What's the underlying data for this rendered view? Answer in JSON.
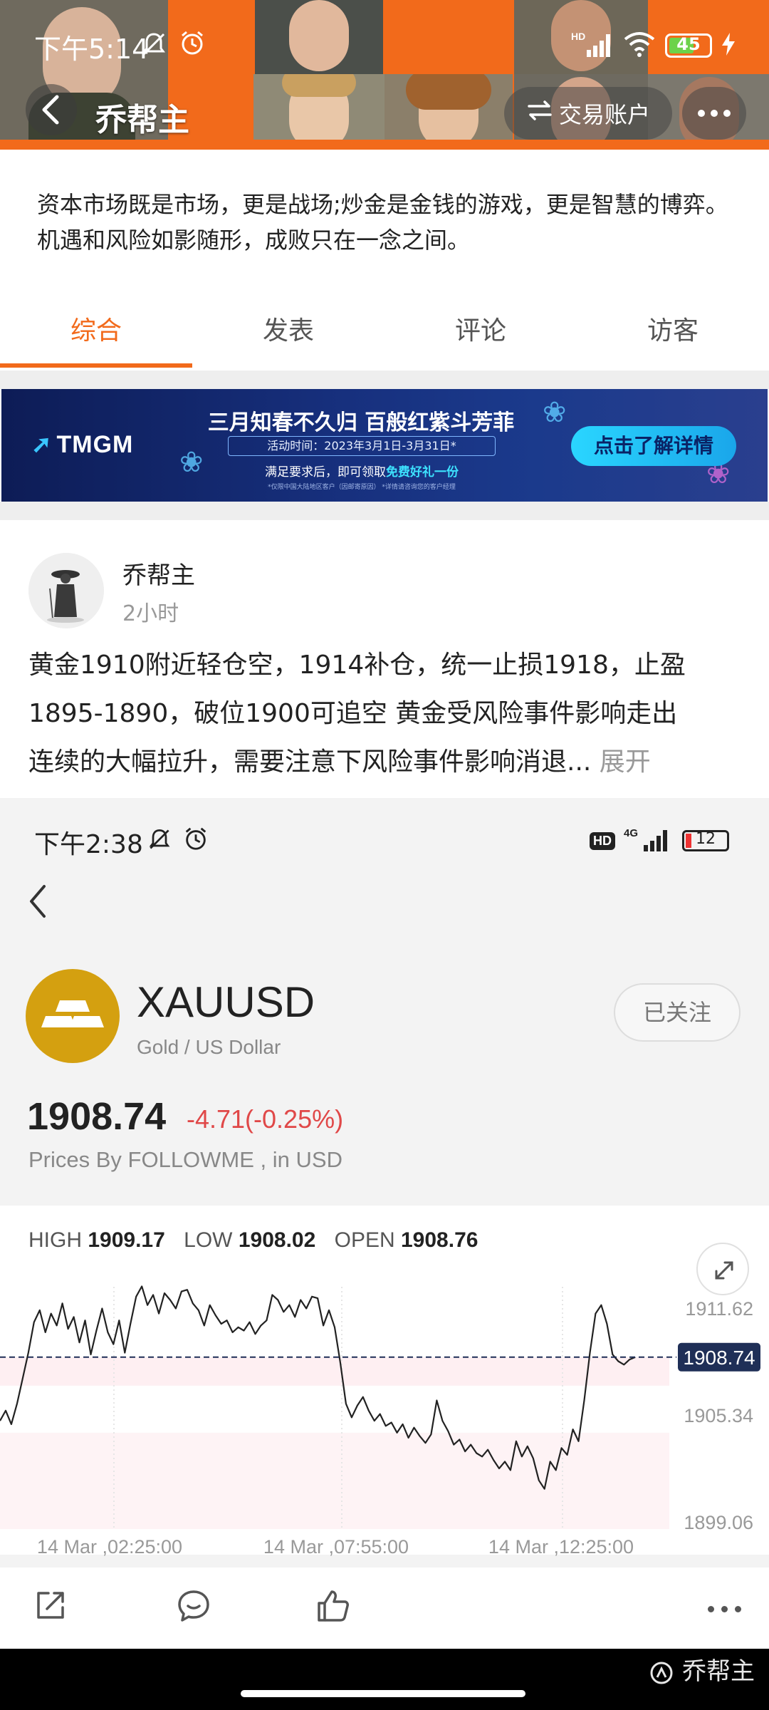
{
  "status_bar": {
    "time": "下午5:14",
    "battery": "45",
    "network": "HD"
  },
  "nav": {
    "title": "乔帮主",
    "trade_label": "交易账户"
  },
  "profile": {
    "bio_line1": "资本市场既是市场，更是战场;炒金是金钱的游戏，更是智慧的博弈。",
    "bio_line2": "机遇和风险如影随形，成败只在一念之间。"
  },
  "tabs": [
    "综合",
    "发表",
    "评论",
    "访客"
  ],
  "banner": {
    "logo": "TMGM",
    "title": "三月知春不久归 百般红紫斗芳菲",
    "date": "活动时间：2023年3月1日-3月31日*",
    "sub_prefix": "满足要求后，即可领取",
    "sub_highlight": "免费好礼一份",
    "note": "*仅限中国大陆地区客户（因邮寄原因） *详情请咨询您的客户经理",
    "cta": "点击了解详情"
  },
  "post": {
    "author": "乔帮主",
    "time": "2小时",
    "line1": "黄金1910附近轻仓空，1914补仓，统一止损1918，止盈",
    "line2": "1895-1890，破位1900可追空 黄金受风险事件影响走出",
    "line3": "连续的大幅拉升，需要注意下风险事件影响消退...",
    "more": "展开"
  },
  "embedded": {
    "status_time": "下午2:38",
    "status_hd": "HD",
    "status_net": "4G",
    "battery": "12",
    "symbol": "XAUUSD",
    "symbol_desc": "Gold / US Dollar",
    "follow_label": "已关注",
    "price": "1908.74",
    "change": "-4.71(-0.25%)",
    "prices_by": "Prices By FOLLOWME , in USD",
    "high_label": "HIGH",
    "high": "1909.17",
    "low_label": "LOW",
    "low": "1908.02",
    "open_label": "OPEN",
    "open": "1908.76"
  },
  "chart_data": {
    "type": "line",
    "y_ticks": [
      "1911.62",
      "1905.34",
      "1899.06"
    ],
    "x_ticks": [
      "14 Mar ,02:25:00",
      "14 Mar ,07:55:00",
      "14 Mar ,12:25:00"
    ],
    "current_price_label": "1908.74",
    "ylim": [
      1899.06,
      1911.62
    ],
    "grid": true,
    "x": [
      0,
      8,
      16,
      24,
      32,
      40,
      48,
      56,
      64,
      72,
      80,
      88,
      96,
      104,
      112,
      120,
      128,
      136,
      144,
      152,
      160,
      168,
      176,
      184,
      192,
      200,
      208,
      216,
      224,
      232,
      240,
      248,
      256,
      264,
      272,
      280,
      288,
      296,
      304,
      312,
      320,
      328,
      336,
      344,
      352,
      360,
      368,
      376,
      384,
      392,
      400,
      408,
      416,
      424,
      432,
      440,
      448,
      456,
      464,
      472,
      480,
      488,
      496,
      504,
      512,
      520,
      528,
      536,
      544,
      552,
      560,
      568,
      576,
      584,
      592,
      600,
      608,
      616,
      624,
      632,
      640,
      648,
      656,
      664,
      672,
      680,
      688,
      696,
      704,
      712,
      720,
      728,
      736,
      744,
      752,
      760,
      768,
      776,
      784,
      792,
      800,
      808,
      816,
      824,
      832,
      840,
      848,
      856,
      864,
      872,
      880,
      888,
      896,
      904,
      912,
      920,
      928,
      936,
      944
    ],
    "values": [
      1905.0,
      1905.6,
      1904.8,
      1906.0,
      1907.5,
      1909.0,
      1910.8,
      1911.5,
      1910.2,
      1911.3,
      1910.6,
      1911.9,
      1910.4,
      1911.1,
      1909.6,
      1910.9,
      1908.9,
      1910.3,
      1911.6,
      1910.2,
      1909.5,
      1910.9,
      1909.0,
      1910.7,
      1912.3,
      1912.9,
      1911.8,
      1912.4,
      1911.3,
      1912.5,
      1912.1,
      1911.6,
      1912.6,
      1912.7,
      1911.9,
      1911.5,
      1910.6,
      1911.8,
      1911.2,
      1910.7,
      1910.9,
      1910.2,
      1910.5,
      1910.3,
      1910.8,
      1910.1,
      1910.6,
      1910.9,
      1912.4,
      1912.1,
      1911.4,
      1911.8,
      1911.1,
      1912.1,
      1911.6,
      1912.3,
      1912.2,
      1910.6,
      1911.5,
      1910.5,
      1908.4,
      1906.0,
      1905.2,
      1905.9,
      1906.4,
      1905.6,
      1905.0,
      1905.4,
      1904.7,
      1904.9,
      1904.3,
      1904.8,
      1904.0,
      1904.6,
      1904.1,
      1903.7,
      1904.2,
      1906.2,
      1905.0,
      1904.4,
      1903.6,
      1903.9,
      1903.2,
      1903.6,
      1903.1,
      1902.9,
      1903.3,
      1902.7,
      1902.2,
      1902.6,
      1902.1,
      1903.8,
      1902.9,
      1903.5,
      1902.8,
      1901.5,
      1901.0,
      1902.6,
      1902.1,
      1903.4,
      1903.0,
      1904.5,
      1903.8,
      1906.2,
      1909.0,
      1911.3,
      1911.8,
      1910.7,
      1908.9,
      1908.5,
      1908.3,
      1908.6,
      1908.74
    ],
    "x_unit": "minutes from chart start"
  }
}
